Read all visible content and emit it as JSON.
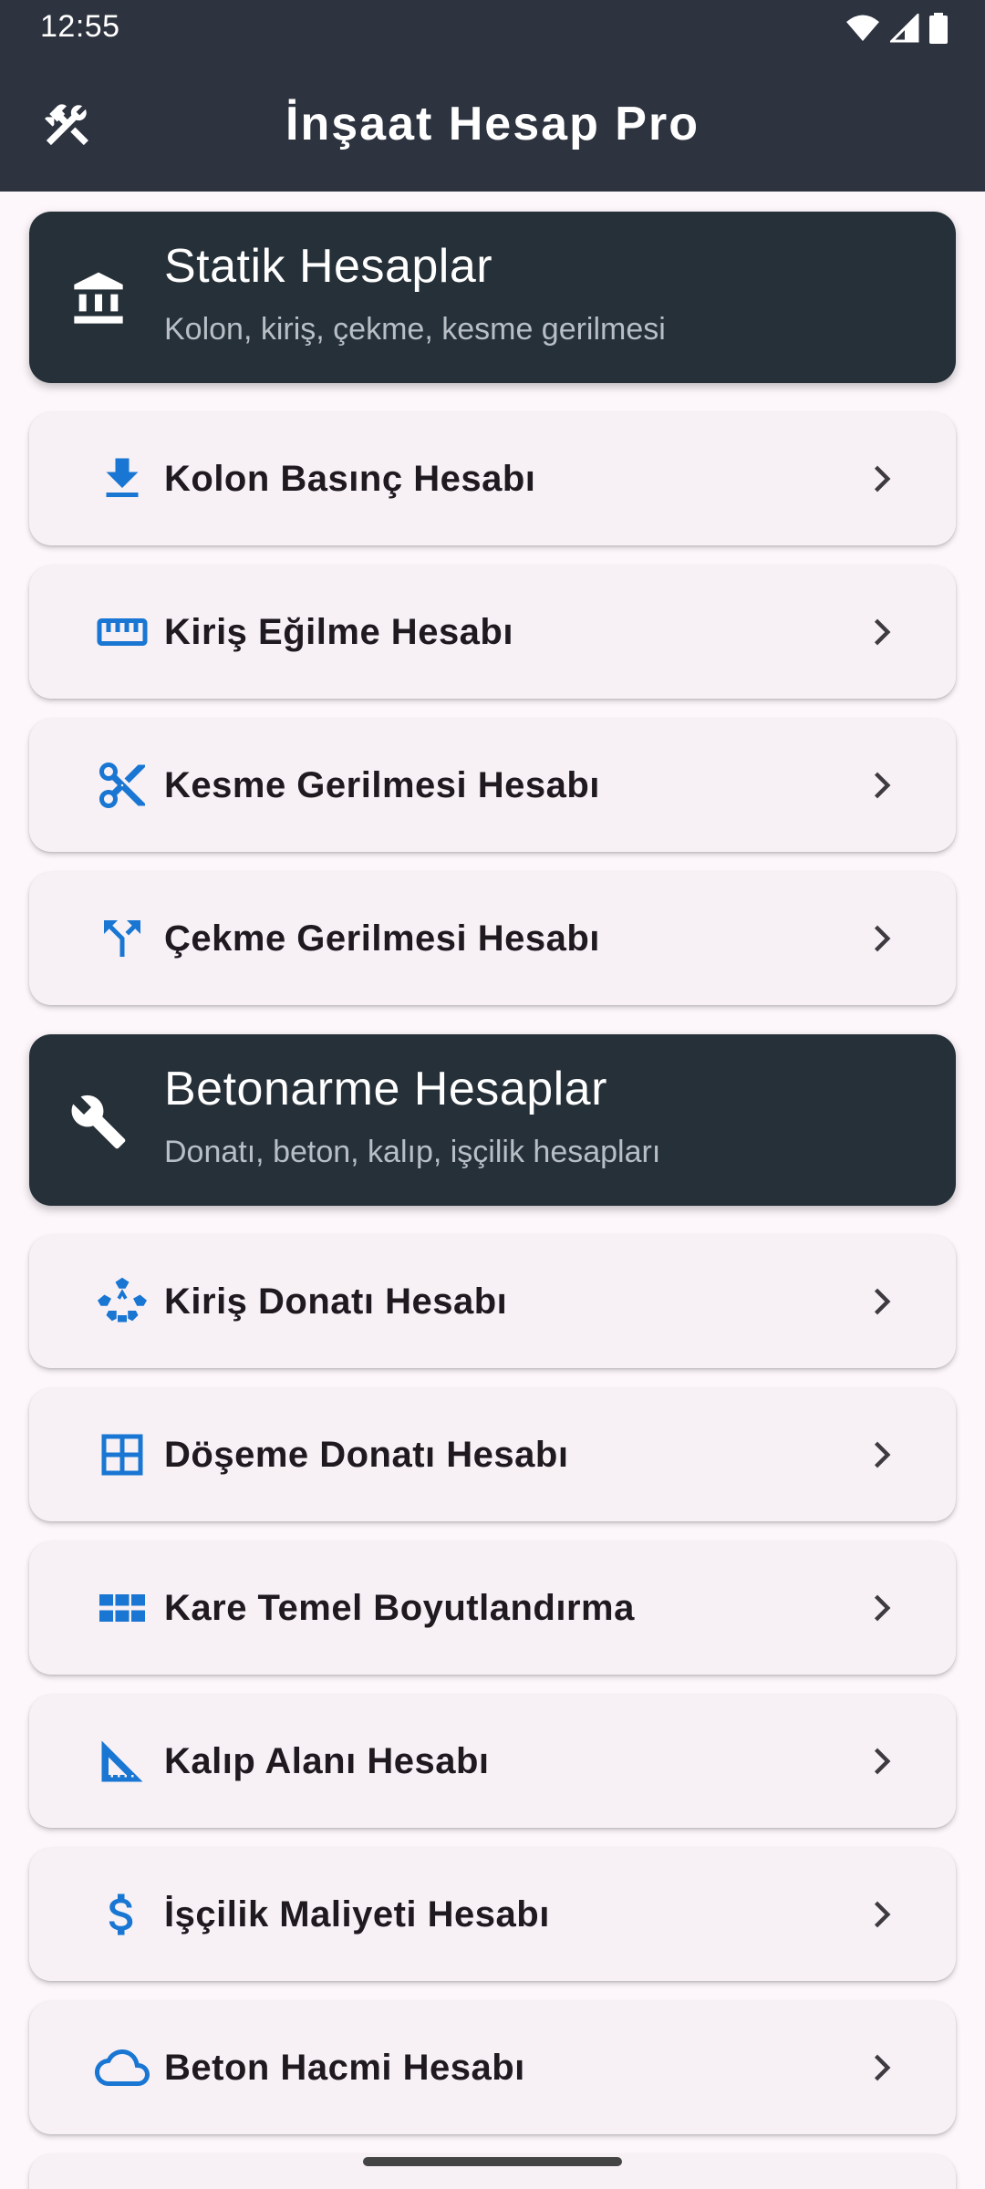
{
  "status_bar": {
    "time": "12:55",
    "icons": [
      "wifi-icon",
      "signal-icon",
      "battery-icon"
    ]
  },
  "app_bar": {
    "title": "İnşaat Hesap Pro",
    "icon": "tools-icon",
    "background": "#2d333f"
  },
  "colors": {
    "accent": "#1976d2",
    "header_card": "#263038",
    "item_card": "#f7f1f6",
    "page_background": "#fdf7fb"
  },
  "sections": [
    {
      "title": "Statik Hesaplar",
      "subtitle": "Kolon, kiriş, çekme, kesme gerilmesi",
      "icon": "bank-icon",
      "items": [
        {
          "label": "Kolon Basınç Hesabı",
          "icon": "download-icon"
        },
        {
          "label": "Kiriş Eğilme Hesabı",
          "icon": "ruler-icon"
        },
        {
          "label": "Kesme Gerilmesi Hesabı",
          "icon": "scissors-icon"
        },
        {
          "label": "Çekme Gerilmesi Hesabı",
          "icon": "call-split-icon"
        }
      ]
    },
    {
      "title": "Betonarme Hesaplar",
      "subtitle": "Donatı, beton, kalıp, işçilik hesapları",
      "icon": "wrench-icon",
      "items": [
        {
          "label": "Kiriş Donatı Hesabı",
          "icon": "recycle-icon"
        },
        {
          "label": "Döşeme Donatı Hesabı",
          "icon": "border-grid-icon"
        },
        {
          "label": "Kare Temel Boyutlandırma",
          "icon": "view-module-icon"
        },
        {
          "label": "Kalıp Alanı Hesabı",
          "icon": "set-square-icon"
        },
        {
          "label": "İşçilik Maliyeti Hesabı",
          "icon": "dollar-icon"
        },
        {
          "label": "Beton Hacmi Hesabı",
          "icon": "cloud-icon"
        }
      ]
    }
  ]
}
